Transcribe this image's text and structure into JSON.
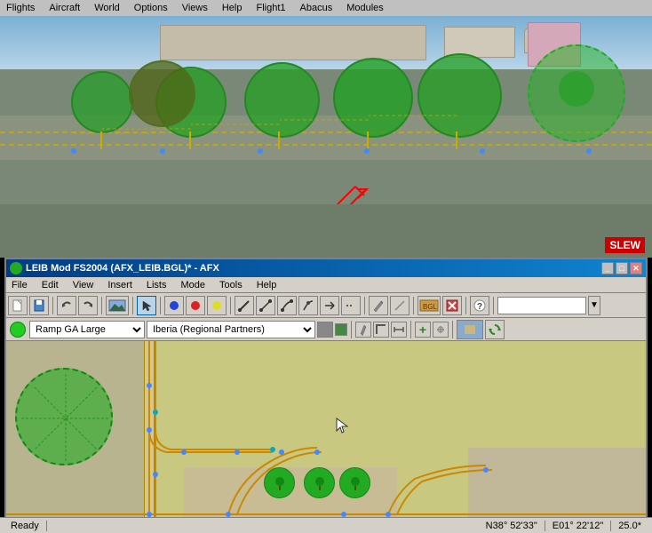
{
  "topMenu": {
    "items": [
      "Flights",
      "Aircraft",
      "World",
      "Options",
      "Views",
      "Help",
      "Flight1",
      "Abacus",
      "Modules"
    ]
  },
  "flightView": {
    "slew": "SLEW"
  },
  "afxWindow": {
    "title": "LEIB Mod FS2004 (AFX_LEIB.BGL)* - AFX",
    "titlebarButtons": [
      "_",
      "□",
      "✕"
    ]
  },
  "afxMenu": {
    "items": [
      "File",
      "Edit",
      "View",
      "Insert",
      "Lists",
      "Mode",
      "Tools",
      "Help"
    ]
  },
  "toolbar": {
    "buttons": [
      "💾",
      "↩",
      "↪"
    ]
  },
  "toolbar2": {
    "rampType": "Ramp GA Large",
    "airline": "Iberia (Regional Partners)"
  },
  "statusBar": {
    "ready": "Ready",
    "coords1": "N38° 52'33\"",
    "coords2": "E01° 22'12\"",
    "zoom": "25.0*"
  }
}
